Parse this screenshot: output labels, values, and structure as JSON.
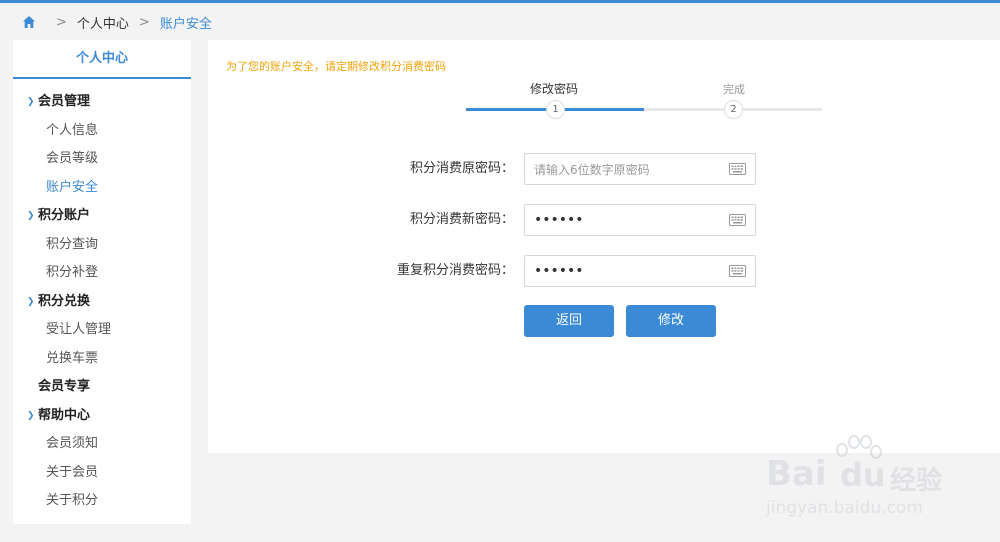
{
  "breadcrumb": {
    "sep1": ">",
    "parent": "个人中心",
    "sep2": ">",
    "current": "账户安全"
  },
  "sidebar": {
    "title": "个人中心",
    "items": [
      {
        "label": "会员管理",
        "type": "group",
        "arrow": true
      },
      {
        "label": "个人信息",
        "type": "sub"
      },
      {
        "label": "会员等级",
        "type": "sub"
      },
      {
        "label": "账户安全",
        "type": "sub",
        "active": true
      },
      {
        "label": "积分账户",
        "type": "group",
        "arrow": true
      },
      {
        "label": "积分查询",
        "type": "sub"
      },
      {
        "label": "积分补登",
        "type": "sub"
      },
      {
        "label": "积分兑换",
        "type": "group",
        "arrow": true
      },
      {
        "label": "受让人管理",
        "type": "sub"
      },
      {
        "label": "兑换车票",
        "type": "sub"
      },
      {
        "label": "会员专享",
        "type": "group",
        "arrow": false
      },
      {
        "label": "帮助中心",
        "type": "group",
        "arrow": true
      },
      {
        "label": "会员须知",
        "type": "sub"
      },
      {
        "label": "关于会员",
        "type": "sub"
      },
      {
        "label": "关于积分",
        "type": "sub"
      }
    ]
  },
  "main": {
    "notice": "为了您的账户安全，请定期修改积分消费密码",
    "steps": [
      {
        "label": "修改密码",
        "number": "1",
        "active": true
      },
      {
        "label": "完成",
        "number": "2",
        "active": false
      }
    ],
    "form": {
      "old_password": {
        "label": "积分消费原密码：",
        "placeholder": "请输入6位数字原密码",
        "value": ""
      },
      "new_password": {
        "label": "积分消费新密码：",
        "value": "••••••"
      },
      "repeat_password": {
        "label": "重复积分消费密码：",
        "value": "••••••"
      }
    },
    "buttons": {
      "back": "返回",
      "submit": "修改"
    }
  },
  "watermark": {
    "brand": "Bai",
    "brand_suffix": "经验",
    "url": "jingyan.baidu.com"
  },
  "colors": {
    "accent": "#3b8ad5",
    "notice": "#f0a30a",
    "background": "#f3f3f3"
  }
}
